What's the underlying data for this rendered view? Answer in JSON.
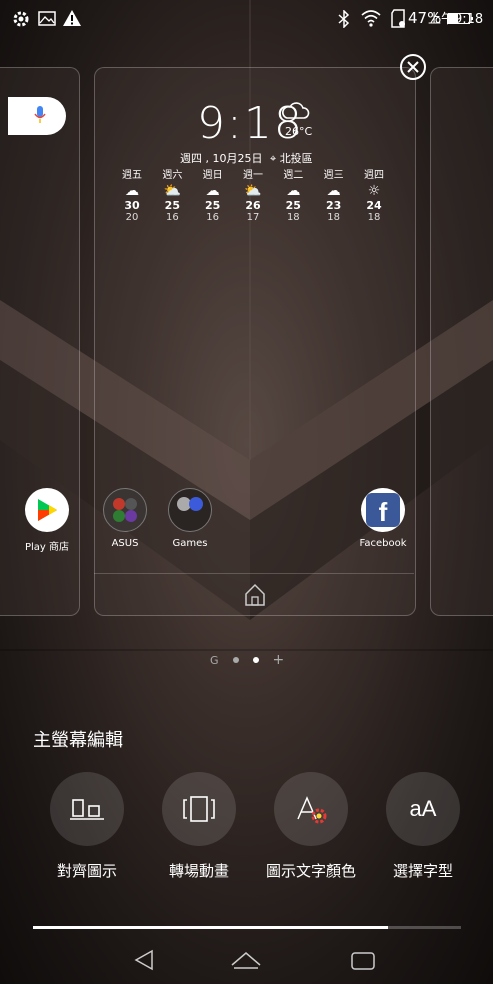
{
  "status_bar": {
    "icons_left": [
      "gear-icon",
      "image-icon",
      "warning-icon"
    ],
    "icons_right": [
      "bluetooth-icon",
      "wifi-icon",
      "sd-card-icon",
      "battery-icon"
    ],
    "battery": "47%",
    "battery_level": 0.47,
    "time": "上午9:18"
  },
  "clock_widget": {
    "time": "9:18",
    "temperature": "26°C",
    "date": "週四 , 10月25日",
    "location": "北投區"
  },
  "forecast": [
    {
      "day": "週五",
      "icon": "rain-cloud-icon",
      "high": "30",
      "low": "20"
    },
    {
      "day": "週六",
      "icon": "sun-cloud-icon",
      "high": "25",
      "low": "16"
    },
    {
      "day": "週日",
      "icon": "cloud-icon",
      "high": "25",
      "low": "16"
    },
    {
      "day": "週一",
      "icon": "sun-cloud-icon",
      "high": "26",
      "low": "17"
    },
    {
      "day": "週二",
      "icon": "cloud-icon",
      "high": "25",
      "low": "18"
    },
    {
      "day": "週三",
      "icon": "cloud-icon",
      "high": "23",
      "low": "18"
    },
    {
      "day": "週四",
      "icon": "sun-icon",
      "high": "24",
      "low": "18"
    }
  ],
  "apps": {
    "play_store": "Play 商店",
    "asus": "ASUS",
    "games": "Games",
    "facebook": "Facebook"
  },
  "page_indicator": {
    "google": "G",
    "add": "+"
  },
  "edit_panel": {
    "title": "主螢幕編輯",
    "tools": [
      "對齊圖示",
      "轉場動畫",
      "圖示文字顏色",
      "選擇字型"
    ],
    "font_sample": "aA"
  },
  "progress": 0.83,
  "colors": {
    "play_green": "#00c853",
    "facebook_blue": "#3b5998",
    "mic_blue": "#4285f4"
  }
}
